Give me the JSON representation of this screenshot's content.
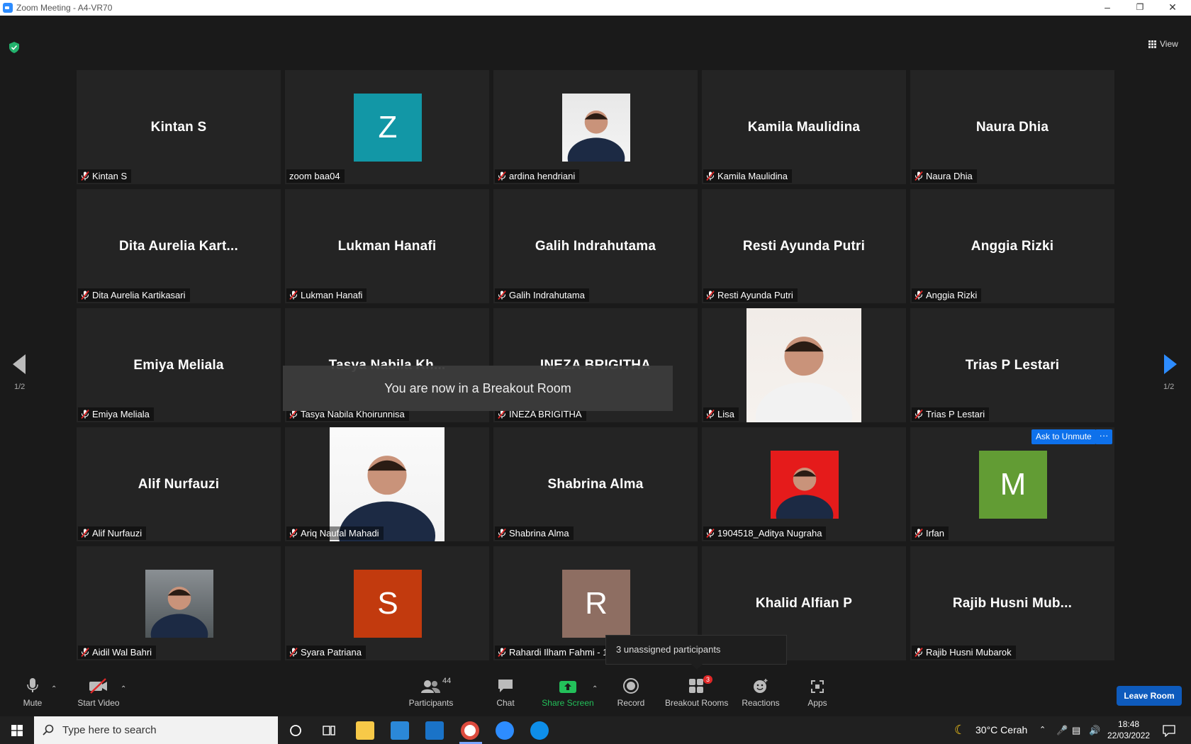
{
  "window": {
    "title": "Zoom Meeting - A4-VR70"
  },
  "top": {
    "view_label": "View"
  },
  "pager": {
    "left": "1/2",
    "right": "1/2"
  },
  "tiles": [
    {
      "big": "Kintan S",
      "label": "Kintan S",
      "type": "name",
      "muted": true
    },
    {
      "big": "",
      "label": "zoom baa04",
      "type": "avatar",
      "letter": "Z",
      "color": "#1297a6",
      "muted": false
    },
    {
      "big": "",
      "label": "ardina hendriani",
      "type": "photo",
      "muted": true
    },
    {
      "big": "Kamila Maulidina",
      "label": "Kamila Maulidina",
      "type": "name",
      "muted": true
    },
    {
      "big": "Naura Dhia",
      "label": "Naura Dhia",
      "type": "name",
      "muted": true
    },
    {
      "big": "Dita  Aurelia  Kart...",
      "label": "Dita Aurelia Kartikasari",
      "type": "name",
      "muted": true
    },
    {
      "big": "Lukman Hanafi",
      "label": "Lukman Hanafi",
      "type": "name",
      "muted": true
    },
    {
      "big": "Galih Indrahutama",
      "label": "Galih Indrahutama",
      "type": "name",
      "muted": true
    },
    {
      "big": "Resti Ayunda Putri",
      "label": "Resti Ayunda Putri",
      "type": "name",
      "muted": true
    },
    {
      "big": "Anggia Rizki",
      "label": "Anggia Rizki",
      "type": "name",
      "muted": true
    },
    {
      "big": "Emiya Meliala",
      "label": "Emiya Meliala",
      "type": "name",
      "muted": true
    },
    {
      "big": "Tasya  Nabila  Kh...",
      "label": "Tasya Nabila Khoirunnisa",
      "type": "name",
      "muted": true
    },
    {
      "big": "INEZA BRIGITHA",
      "label": "INEZA BRIGITHA",
      "type": "name",
      "muted": true
    },
    {
      "big": "",
      "label": "Lisa",
      "type": "photo",
      "muted": true
    },
    {
      "big": "Trias P Lestari",
      "label": "Trias P Lestari",
      "type": "name",
      "muted": true
    },
    {
      "big": "Alif Nurfauzi",
      "label": "Alif Nurfauzi",
      "type": "name",
      "muted": true
    },
    {
      "big": "",
      "label": "Ariq Naufal Mahadi",
      "type": "photo",
      "muted": true
    },
    {
      "big": "Shabrina Alma",
      "label": "Shabrina Alma",
      "type": "name",
      "muted": true
    },
    {
      "big": "",
      "label": "1904518_Aditya Nugraha",
      "type": "photo",
      "muted": true
    },
    {
      "big": "",
      "label": "Irfan",
      "type": "avatar",
      "letter": "M",
      "color": "#629c34",
      "muted": true
    },
    {
      "big": "",
      "label": "Aidil Wal Bahri",
      "type": "photo",
      "muted": true
    },
    {
      "big": "",
      "label": "Syara Patriana",
      "type": "avatar",
      "letter": "S",
      "color": "#c23a0e",
      "muted": true
    },
    {
      "big": "",
      "label": "Rahardi Ilham Fahmi - 1",
      "type": "avatar",
      "letter": "R",
      "color": "#8e6e62",
      "muted": true
    },
    {
      "big": "Khalid Alfian P",
      "label": "",
      "type": "name",
      "muted": false
    },
    {
      "big": "Rajib  Husni  Mub...",
      "label": "Rajib Husni Mubarok",
      "type": "name",
      "muted": true
    }
  ],
  "toast": "You are now in a Breakout Room",
  "tooltip": "3 unassigned participants",
  "ask_unmute": "Ask to Unmute",
  "more_dots": "···",
  "toolbar": {
    "mute": "Mute",
    "start_video": "Start Video",
    "participants": "Participants",
    "participants_count": "44",
    "chat": "Chat",
    "share_screen": "Share Screen",
    "record": "Record",
    "breakout_rooms": "Breakout Rooms",
    "breakout_badge": "3",
    "reactions": "Reactions",
    "apps": "Apps",
    "leave": "Leave Room"
  },
  "taskbar": {
    "search_placeholder": "Type here to search",
    "weather": "30°C  Cerah",
    "time": "18:48",
    "date": "22/03/2022"
  }
}
